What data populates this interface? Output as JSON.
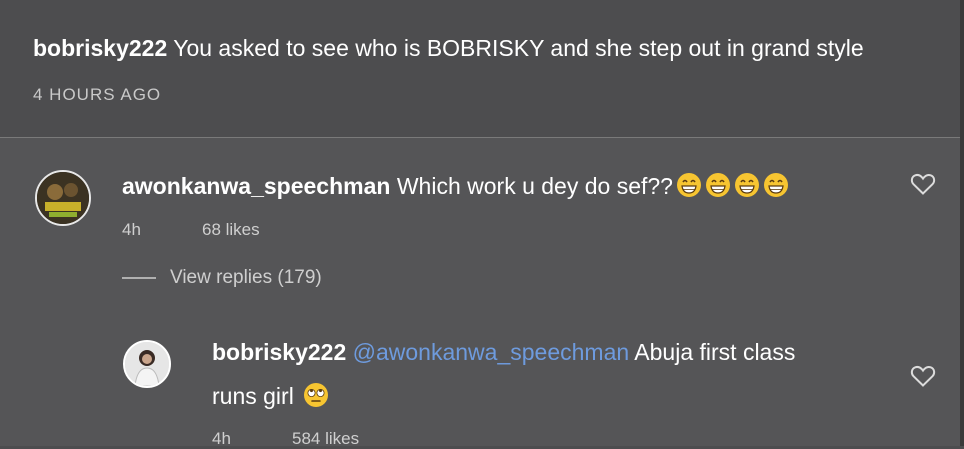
{
  "post": {
    "username": "bobrisky222",
    "caption": "You asked to see who is BOBRISKY and she step out in grand style",
    "time": "4 HOURS AGO"
  },
  "comments": [
    {
      "username": "awonkanwa_speechman",
      "text": "Which work u dey do sef??",
      "emoji": "grinning-face-emoji",
      "age": "4h",
      "likes": "68 likes",
      "view_replies": "View replies (179)"
    }
  ],
  "reply": {
    "username": "bobrisky222",
    "mention": "@awonkanwa_speechman",
    "text_line1": "Abuja first class",
    "text_line2": "runs girl",
    "emoji": "rolling-eyes-emoji",
    "age": "4h",
    "likes": "584 likes"
  },
  "colors": {
    "background": "#4d4d4f",
    "comment_bg": "#555557",
    "mention": "#6e9bde",
    "muted": "#c9c9c9"
  },
  "icons": [
    "heart-icon"
  ]
}
